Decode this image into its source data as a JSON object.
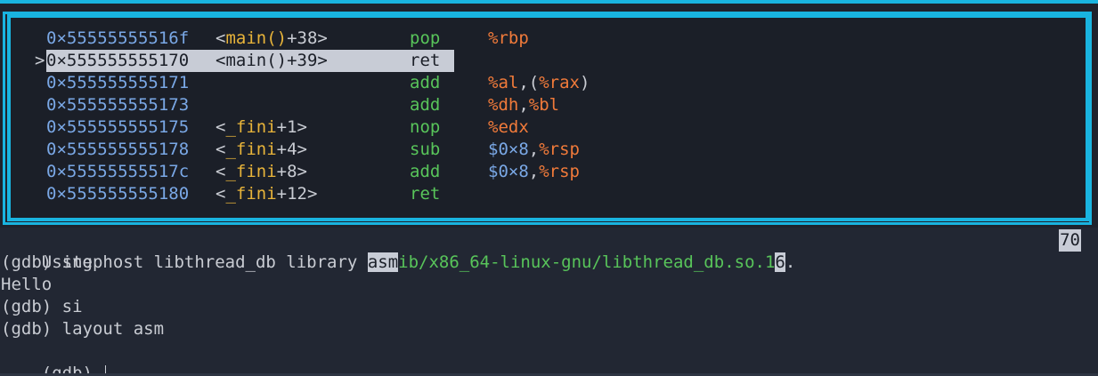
{
  "colors": {
    "frame": "#19b4e0",
    "address": "#7aa8e6",
    "mnemonic": "#58c45a",
    "register": "#f07a3a",
    "function": "#e8b43a",
    "background": "#222733"
  },
  "asm": {
    "current_marker": ">",
    "lines": [
      {
        "addr": "0×55555555516f",
        "sym_open": "<",
        "sym_fn": "main()",
        "sym_close": "+38>",
        "mnem": "pop",
        "ops": [
          "%rbp"
        ]
      },
      {
        "addr": "0×555555555170",
        "sym_open": "<",
        "sym_fn": "main()",
        "sym_close": "+39>",
        "mnem": "ret",
        "ops": [],
        "current": true
      },
      {
        "addr": "0×555555555171",
        "sym_open": "",
        "sym_fn": "",
        "sym_close": "",
        "mnem": "add",
        "ops": [
          "%al",
          ",(",
          "%rax",
          ")"
        ]
      },
      {
        "addr": "0×555555555173",
        "sym_open": "",
        "sym_fn": "",
        "sym_close": "",
        "mnem": "add",
        "ops": [
          "%dh",
          ",",
          "%bl"
        ]
      },
      {
        "addr": "0×555555555175",
        "sym_open": "<",
        "sym_fn": "_fini",
        "sym_close": "+1>",
        "mnem": "nop",
        "ops": [
          "%edx"
        ]
      },
      {
        "addr": "0×555555555178",
        "sym_open": "<",
        "sym_fn": "_fini",
        "sym_close": "+4>",
        "mnem": "sub",
        "ops": [
          "$0×8",
          ",",
          "%rsp"
        ]
      },
      {
        "addr": "0×55555555517c",
        "sym_open": "<",
        "sym_fn": "_fini",
        "sym_close": "+8>",
        "mnem": "add",
        "ops": [
          "$0×8",
          ",",
          "%rsp"
        ]
      },
      {
        "addr": "0×555555555180",
        "sym_open": "<",
        "sym_fn": "_fini",
        "sym_close": "+12>",
        "mnem": "ret",
        "ops": []
      }
    ]
  },
  "console": {
    "line1_prefix": "Using host libthread_db library ",
    "line1_sel": "asm",
    "line1_path": "ib/x86_64-linux-gnu/libthread_db.so.1",
    "line1_sel2": "6",
    "line1_suffix": ".",
    "line1_count": "70",
    "lines": [
      "(gdb) step",
      "Hello",
      "(gdb) si",
      "(gdb) layout asm"
    ],
    "prompt": "(gdb) "
  }
}
